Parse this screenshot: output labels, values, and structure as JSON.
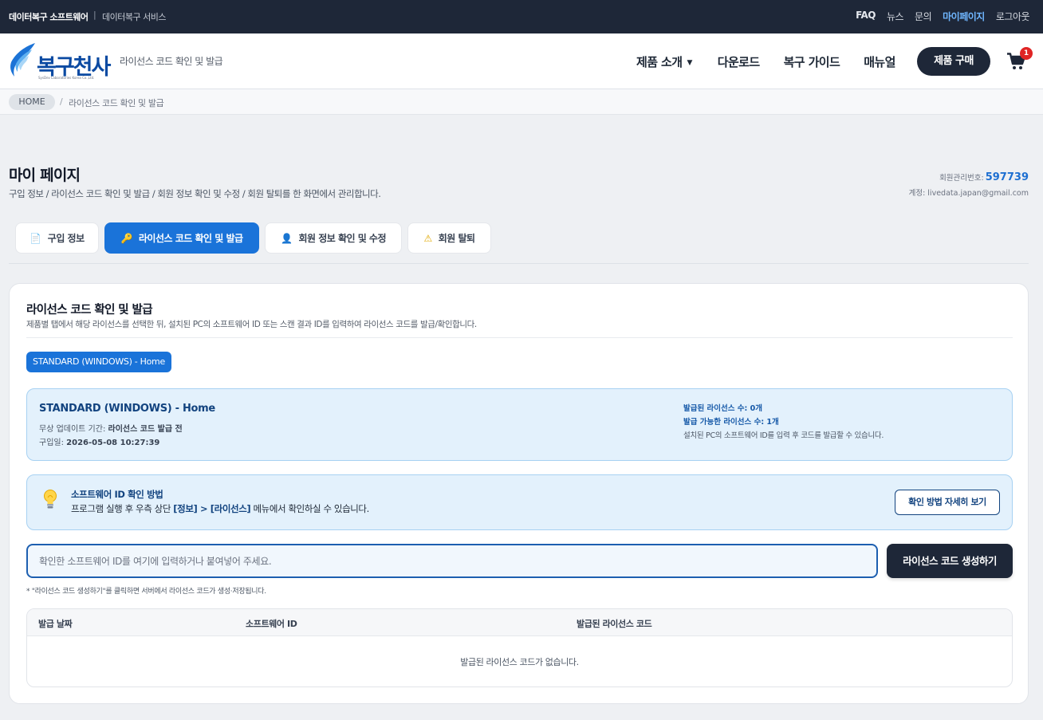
{
  "topbar": {
    "brand": "데이터복구 소프트웨어",
    "divider": "|",
    "service": "데이터복구 서비스",
    "links": [
      "FAQ",
      "뉴스",
      "문의",
      "마이페이지",
      "로그아웃"
    ]
  },
  "header": {
    "logo_text": "복구천사",
    "logo_sub": "SysDev Laboratories Korea Co.,Ltd.",
    "page_label": "라이선스 코드 확인 및 발급",
    "nav": {
      "products": "제품 소개",
      "download": "다운로드",
      "guide": "복구 가이드",
      "manual": "매뉴얼"
    },
    "buy_label": "제품 구매",
    "cart_count": "1"
  },
  "breadcrumb": {
    "home": "HOME",
    "separator": "/",
    "current": "라이선스 코드 확인 및 발급"
  },
  "page": {
    "title": "마이 페이지",
    "description": "구입 정보 / 라이선스 코드 확인 및 발급 / 회원 정보 확인 및 수정 / 회원 탈퇴를 한 화면에서 관리합니다.",
    "member_no_label": "회원관리번호:",
    "member_no": "597739",
    "account": "계정: livedata.japan@gmail.com"
  },
  "tabs": [
    {
      "label": "구입 정보",
      "icon": "📄"
    },
    {
      "label": "라이선스 코드 확인 및 발급",
      "icon": "🔑"
    },
    {
      "label": "회원 정보 확인 및 수정",
      "icon": "👤"
    },
    {
      "label": "회원 탈퇴",
      "icon": "⚠"
    }
  ],
  "license": {
    "title": "라이선스 코드 확인 및 발급",
    "description": "제품별 탭에서 해당 라이선스를 선택한 뒤, 설치된 PC의 소프트웨어 ID 또는 스캔 결과 ID를 입력하여 라이선스 코드를 발급/확인합니다.",
    "product_chip": "STANDARD (WINDOWS) - Home",
    "info": {
      "name": "STANDARD (WINDOWS) - Home",
      "update_label": "무상 업데이트 기간:",
      "update_value": "라이선스 코드 발급 전",
      "purchase_label": "구입일:",
      "purchase_value": "2026-05-08 10:27:39",
      "issued": "발급된 라이선스 수: 0개",
      "available": "발급 가능한 라이선스 수: 1개",
      "note": "설치된 PC의 소프트웨어 ID를 입력 후 코드를 발급할 수 있습니다."
    },
    "help": {
      "title": "소프트웨어 ID 확인 방법",
      "text_prefix": "프로그램 실행 후 우측 상단",
      "text_bold": "[정보] > [라이선스]",
      "text_suffix": "메뉴에서 확인하실 수 있습니다.",
      "button": "확인 방법 자세히 보기"
    },
    "input_placeholder": "확인한 소프트웨어 ID를 여기에 입력하거나 붙여넣어 주세요.",
    "input_value": "",
    "generate_button": "라이선스 코드 생성하기",
    "generate_note": "* \"라이선스 코드 생성하기\"를 클릭하면 서버에서 라이선스 코드가 생성·저장됩니다.",
    "table": {
      "headers": [
        "발급 날짜",
        "소프트웨어 ID",
        "발급된 라이선스 코드"
      ],
      "empty": "발급된 라이선스 코드가 없습니다."
    }
  },
  "colors": {
    "topbar": "#1e2738",
    "accent": "#1a73d9",
    "active_link": "#6fb6ff",
    "info_bg": "#e3f1fc",
    "badge": "#e02424"
  }
}
